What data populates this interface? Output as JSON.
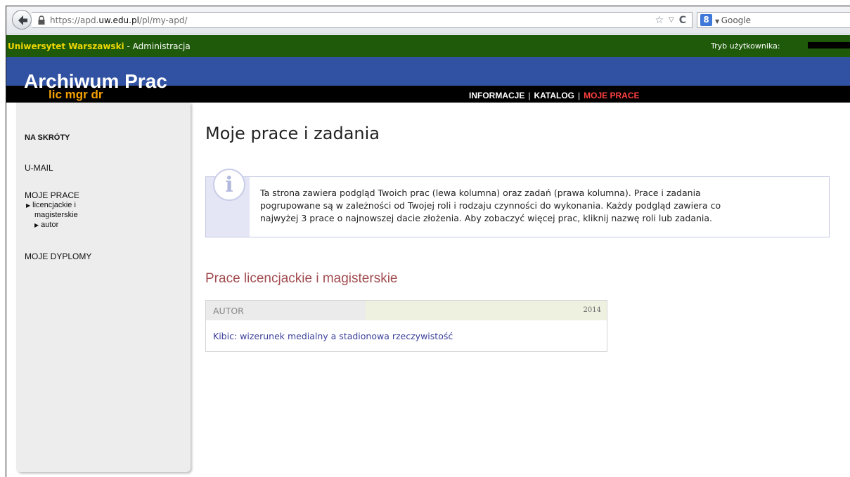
{
  "browser": {
    "url_prefix": "https://apd.",
    "url_domain": "uw.edu.pl",
    "url_path": "/pl/my-apd/",
    "search_engine": "Google",
    "search_engine_icon": "8"
  },
  "top_bar": {
    "university": "Uniwersytet Warszawski",
    "section": " - Administracja",
    "user_mode_label": "Tryb użytkownika:"
  },
  "logo": {
    "title": "Archiwum Prac",
    "subtitle": "lic mgr dr"
  },
  "nav": {
    "items": [
      "INFORMACJE",
      "KATALOG",
      "MOJE PRACE"
    ],
    "separator": "|"
  },
  "sidebar": {
    "shortcuts": "NA SKRÓTY",
    "umail": "U-MAIL",
    "my_works": "MOJE PRACE",
    "sub_licencjackie": "licencjackie i",
    "sub_magisterskie": "magisterskie",
    "sub_autor": "autor",
    "my_diplomas": "MOJE DYPLOMY"
  },
  "main": {
    "title": "Moje prace i zadania",
    "info_icon": "i",
    "info_line1": "Ta strona zawiera podgląd Twoich prac (lewa kolumna) oraz zadań (prawa kolumna). Prace i zadania",
    "info_line2": "pogrupowane są w zależności od Twojej roli i rodzaju czynności do wykonania. Każdy podgląd zawiera co",
    "info_line3": "najwyżej 3 prace o najnowszej dacie złożenia. Aby zobaczyć więcej prac, kliknij nazwę roli lub zadania.",
    "section_title": "Prace licencjackie i magisterskie",
    "table": {
      "role": "AUTOR",
      "year": "2014",
      "work_title": "Kibic: wizerunek medialny a stadionowa rzeczywistość"
    }
  }
}
